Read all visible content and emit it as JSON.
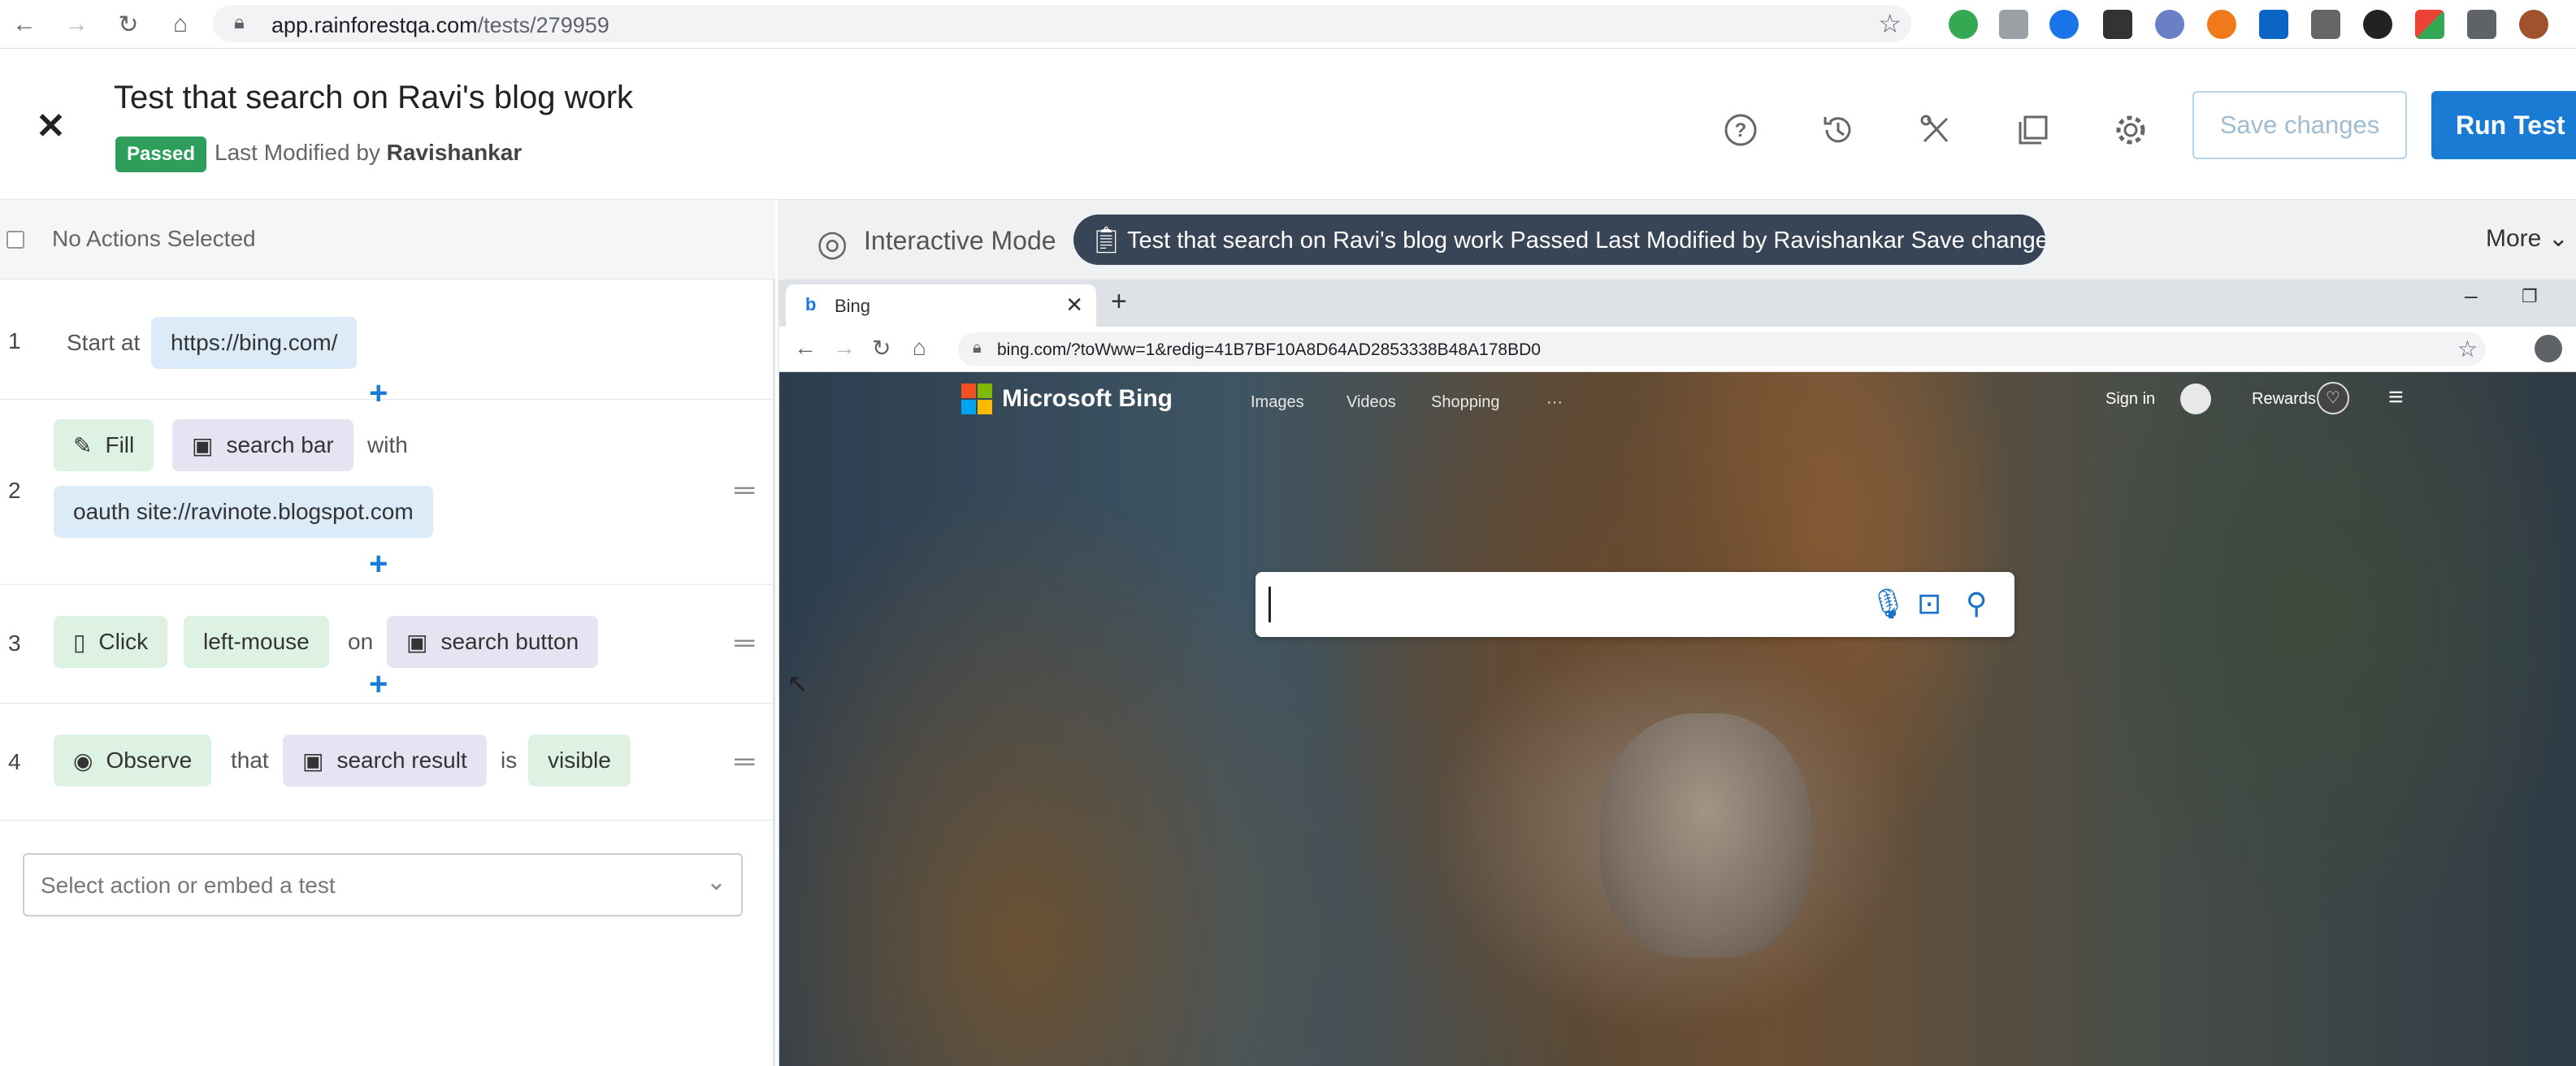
{
  "browser": {
    "url_host": "app.rainforestqa.com",
    "url_path": "/tests/279959"
  },
  "header": {
    "title": "Test that search on Ravi's blog work",
    "status": "Passed",
    "modified_prefix": "Last Modified by",
    "modified_by": "Ravishankar",
    "save_label": "Save changes",
    "run_label": "Run Test"
  },
  "left_panel": {
    "select_label": "No Actions Selected",
    "steps": [
      {
        "num": "1",
        "start_at": "Start at",
        "url": "https://bing.com/"
      },
      {
        "num": "2",
        "action": "Fill",
        "target": "search bar",
        "with": "with",
        "value": "oauth site://ravinote.blogspot.com"
      },
      {
        "num": "3",
        "action": "Click",
        "button": "left-mouse",
        "on": "on",
        "target": "search button"
      },
      {
        "num": "4",
        "action": "Observe",
        "that": "that",
        "target": "search result",
        "is": "is",
        "state": "visible"
      }
    ],
    "action_placeholder": "Select action or embed a test"
  },
  "right_panel": {
    "mode_label": "Interactive Mode",
    "toast": "Test that search on Ravi's blog work Passed Last Modified by Ravishankar Save changes...",
    "more_label": "More"
  },
  "inner_browser": {
    "tab_title": "Bing",
    "url": "bing.com/?toWww=1&redig=41B7BF10A8D64AD2853338B48A178BD0"
  },
  "bing": {
    "logo_text": "Microsoft Bing",
    "nav": [
      "Images",
      "Videos",
      "Shopping",
      "···"
    ],
    "sign_in": "Sign in",
    "rewards": "Rewards"
  },
  "icons": {
    "close": "close-icon",
    "help": "help-icon",
    "history": "history-icon",
    "tools": "tools-icon",
    "copy": "copy-icon",
    "settings": "gear-icon"
  },
  "colors": {
    "primary": "#1a7bd5",
    "passed": "#2e9e5b",
    "toast_bg": "#384556"
  }
}
